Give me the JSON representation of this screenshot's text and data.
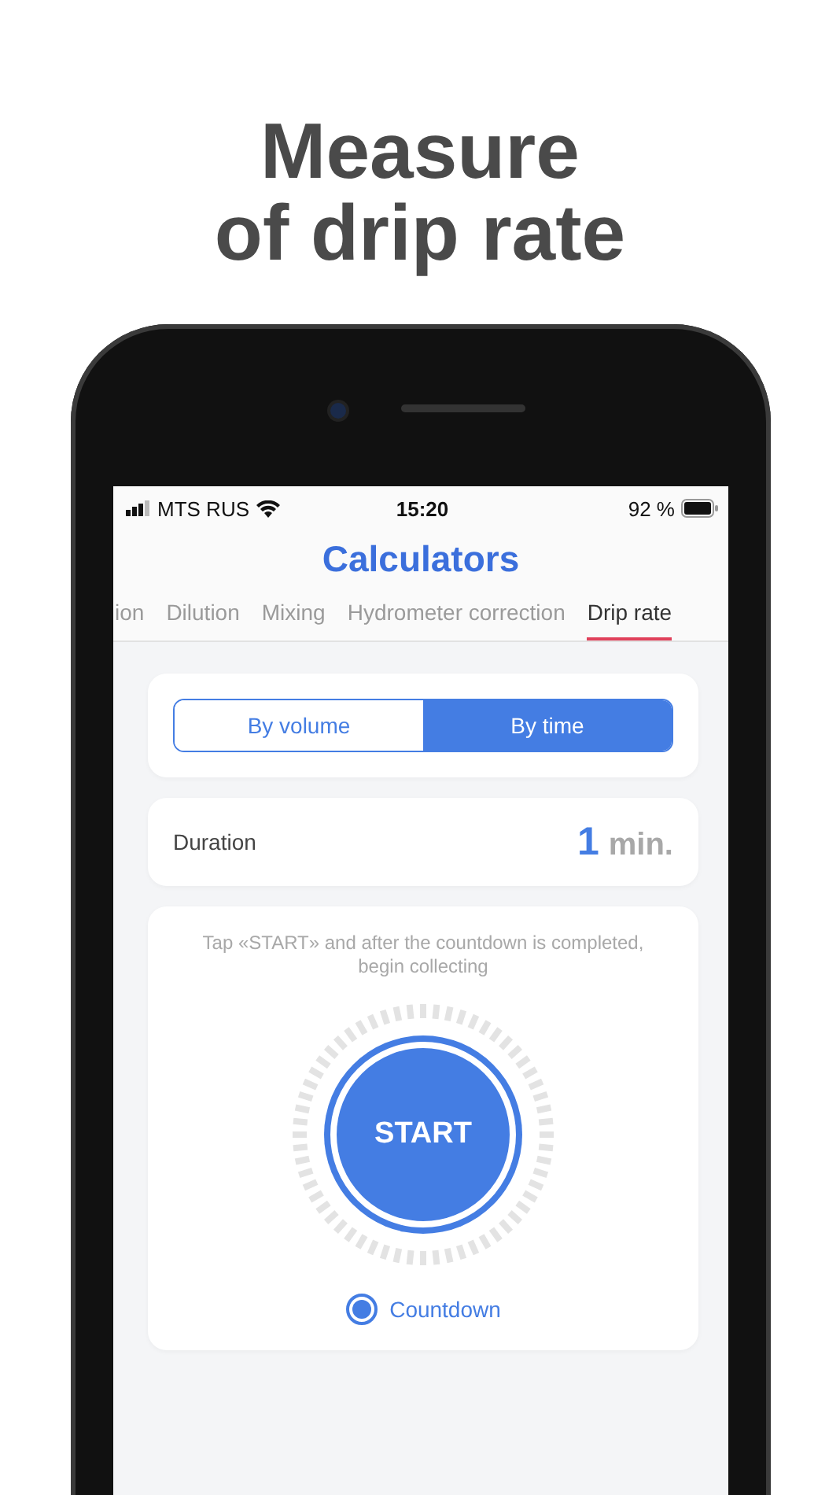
{
  "headline": {
    "lines": [
      "Measure",
      "of drip rate"
    ]
  },
  "status_bar": {
    "carrier": "MTS RUS",
    "time": "15:20",
    "battery": "92 %"
  },
  "title": "Calculators",
  "tabs": [
    {
      "label": "ion",
      "selected": false
    },
    {
      "label": "Dilution",
      "selected": false
    },
    {
      "label": "Mixing",
      "selected": false
    },
    {
      "label": "Hydrometer correction",
      "selected": false
    },
    {
      "label": "Drip rate",
      "selected": true
    }
  ],
  "mode_switch": [
    {
      "label": "By volume",
      "selected": false
    },
    {
      "label": "By time",
      "selected": true
    }
  ],
  "duration": {
    "label": "Duration",
    "value": "1",
    "unit": "min."
  },
  "timer": {
    "hint": "Tap «START» and after the countdown is completed, begin collecting",
    "button": "START",
    "option": {
      "label": "Countdown",
      "checked": true
    }
  }
}
